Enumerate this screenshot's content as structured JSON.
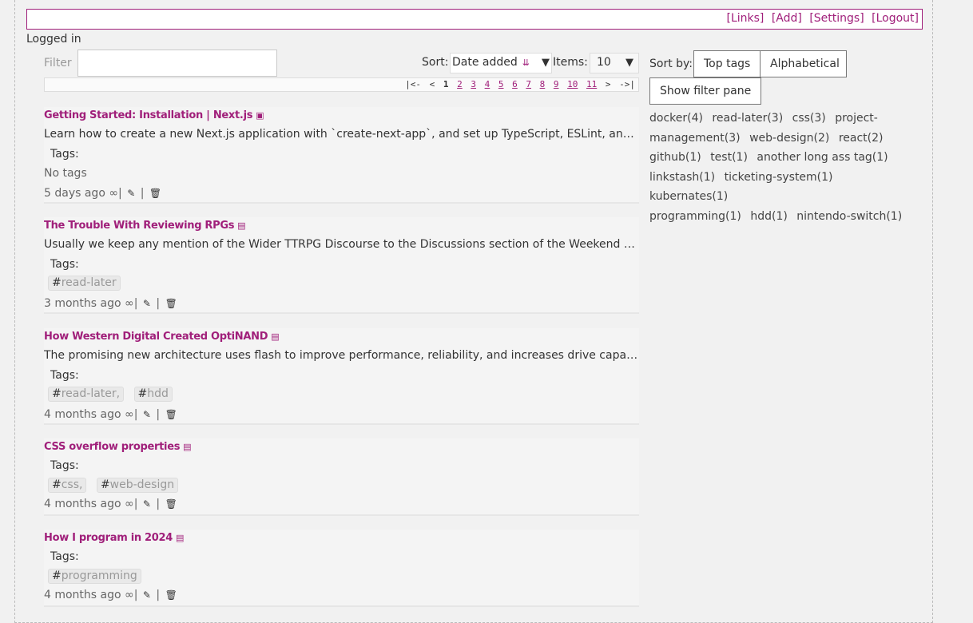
{
  "topbar": {
    "links": [
      "[Links]",
      "[Add]",
      "[Settings]",
      "[Logout]"
    ]
  },
  "status": "Logged in",
  "filter": {
    "label": "Filter",
    "value": ""
  },
  "sort": {
    "label": "Sort:",
    "value": "Date added",
    "icon": "sort-desc-icon"
  },
  "items": {
    "label": "Items:",
    "value": "10"
  },
  "pager": {
    "first": "|<-",
    "prev": "<",
    "current": "1",
    "pages": [
      "2",
      "3",
      "4",
      "5",
      "6",
      "7",
      "8",
      "9",
      "10",
      "11"
    ],
    "next": ">",
    "last": "->|"
  },
  "bookmarks": [
    {
      "title": "Getting Started: Installation | Next.js",
      "icon": "archive-icon",
      "description": "Learn how to create a new Next.js application with `create-next-app`, and set up TypeScript, ESLint, and Module Path Aliases.",
      "tags_label": "Tags:",
      "no_tags": "No tags",
      "tags": [],
      "age": "5 days ago"
    },
    {
      "title": "The Trouble With Reviewing RPGs",
      "icon": "reader-icon",
      "description": "Usually we keep any mention of the Wider TTRPG Discourse to the Discussions section of the Weekend Update, but this one deserves more.",
      "tags_label": "Tags:",
      "tags": [
        {
          "hash": "#",
          "name": "read-later"
        }
      ],
      "age": "3 months ago"
    },
    {
      "title": "How Western Digital Created OptiNAND",
      "icon": "reader-icon",
      "description": "The promising new architecture uses flash to improve performance, reliability, and increases drive capacity.",
      "tags_label": "Tags:",
      "tags": [
        {
          "hash": "#",
          "name": "read-later,"
        },
        {
          "hash": "#",
          "name": "hdd"
        }
      ],
      "age": "4 months ago"
    },
    {
      "title": "CSS overflow properties",
      "icon": "reader-icon",
      "description": "",
      "tags_label": "Tags:",
      "tags": [
        {
          "hash": "#",
          "name": "css,"
        },
        {
          "hash": "#",
          "name": "web-design"
        }
      ],
      "age": "4 months ago"
    },
    {
      "title": "How I program in 2024",
      "icon": "reader-icon",
      "description": "",
      "tags_label": "Tags:",
      "tags": [
        {
          "hash": "#",
          "name": "programming"
        }
      ],
      "age": "4 months ago"
    }
  ],
  "meta_symbols": {
    "link": "∞",
    "sep": "|",
    "edit": "✎",
    "delete": "🗑"
  },
  "sidebar": {
    "sort_label": "Sort by:",
    "top_tags": "Top tags",
    "alphabetical": "Alphabetical",
    "show_filter": "Show filter pane",
    "tags": [
      "docker(4)",
      "read-later(3)",
      "css(3)",
      "project-management(3)",
      "web-design(2)",
      "react(2)",
      "github(1)",
      "test(1)",
      "another long ass tag(1)",
      "linkstash(1)",
      "ticketing-system(1)",
      "kubernates(1)",
      "programming(1)",
      "hdd(1)",
      "nintendo-switch(1)"
    ]
  }
}
